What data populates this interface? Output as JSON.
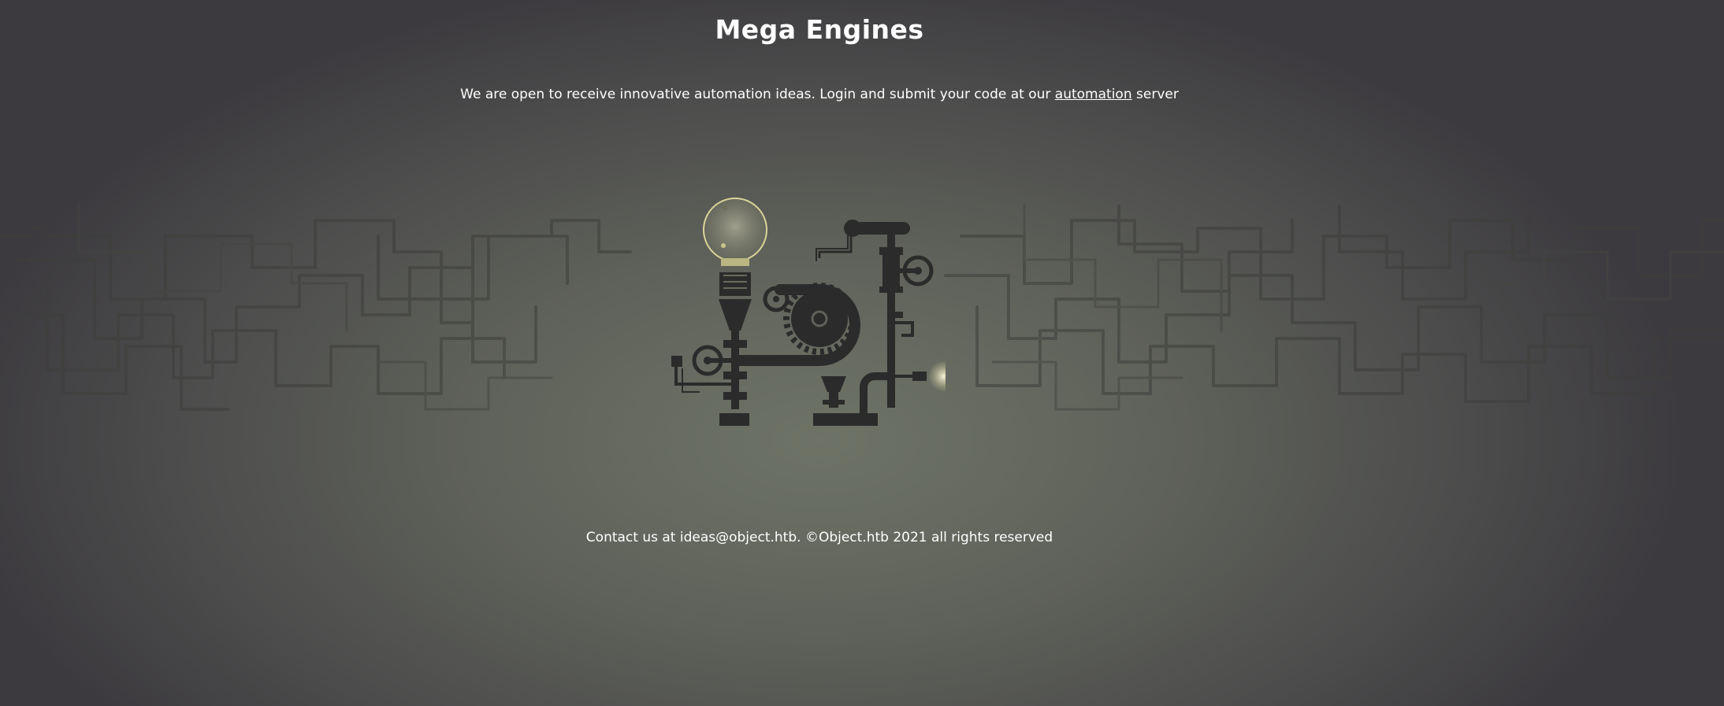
{
  "header": {
    "title": "Mega Engines"
  },
  "intro": {
    "text_before": "We are open to receive innovative automation ideas. Login and submit your code at our ",
    "link_label": "automation",
    "text_after": " server"
  },
  "footer": {
    "text": "Contact us at ideas@object.htb. ©Object.htb 2021 all rights reserved"
  },
  "illustration": {
    "icon": "steampunk-machine-icon"
  },
  "colors": {
    "text": "#ffffff",
    "machine": "#2b2b2b",
    "bulb_glow": "#e6e2b4"
  }
}
